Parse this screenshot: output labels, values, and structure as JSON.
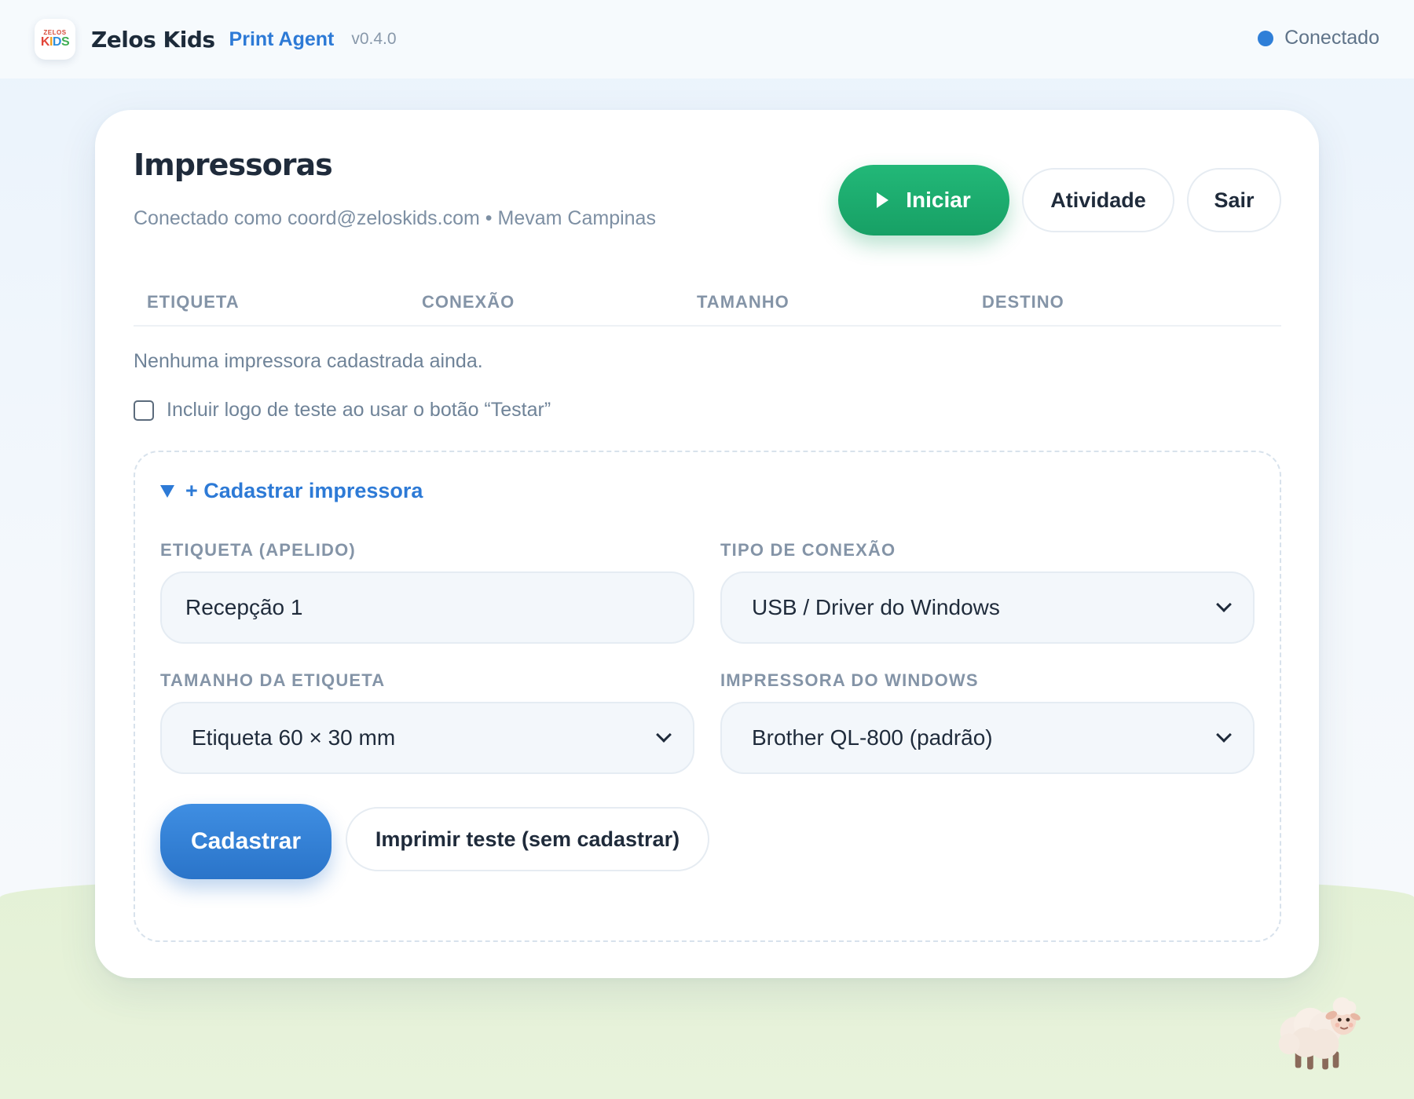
{
  "header": {
    "logo_top": "ZELOS",
    "logo_bottom": [
      "K",
      "I",
      "D",
      "S"
    ],
    "brand": "Zelos Kids",
    "product": "Print Agent",
    "version": "v0.4.0",
    "status": "Conectado",
    "status_color": "#2f7fd8"
  },
  "card": {
    "title": "Impressoras",
    "subtitle": "Conectado como coord@zeloskids.com • Mevam Campinas",
    "actions": {
      "start": "Iniciar",
      "activity": "Atividade",
      "logout": "Sair"
    }
  },
  "table": {
    "columns": [
      "ETIQUETA",
      "CONEXÃO",
      "TAMANHO",
      "DESTINO"
    ],
    "rows": [],
    "empty_text": "Nenhuma impressora cadastrada ainda."
  },
  "test_logo_option": {
    "label": "Incluir logo de teste ao usar o botão “Testar”",
    "checked": false
  },
  "register_form": {
    "summary": "+ Cadastrar impressora",
    "expanded": true,
    "label_field": {
      "label": "ETIQUETA (APELIDO)",
      "value": "Recepção 1"
    },
    "connection_field": {
      "label": "TIPO DE CONEXÃO",
      "value": "USB / Driver do Windows"
    },
    "size_field": {
      "label": "TAMANHO DA ETIQUETA",
      "value": "Etiqueta 60 × 30 mm"
    },
    "printer_field": {
      "label": "IMPRESSORA DO WINDOWS",
      "value": "Brother QL-800 (padrão)"
    },
    "submit": "Cadastrar",
    "test_print": "Imprimir teste (sem cadastrar)"
  },
  "colors": {
    "primary": "#2d7ad6",
    "success": "#1aab6e",
    "text": "#1f2b3b",
    "muted": "#8494a7"
  },
  "decorations": {
    "mascot": "sheep-mascot"
  }
}
